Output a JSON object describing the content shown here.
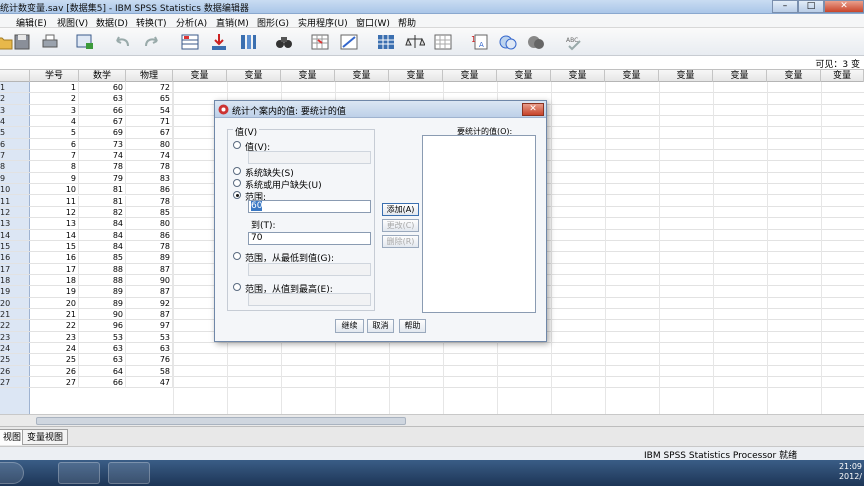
{
  "window": {
    "title": "统计数变量.sav [数据集5] - IBM SPSS Statistics 数据编辑器",
    "min": "–",
    "max": "□",
    "close": "✕"
  },
  "menu": [
    "编辑(E)",
    "视图(V)",
    "数据(D)",
    "转换(T)",
    "分析(A)",
    "直销(M)",
    "图形(G)",
    "实用程序(U)",
    "窗口(W)",
    "帮助"
  ],
  "visible_label": "可见：3 变",
  "columns": [
    "学号",
    "数学",
    "物理",
    "变量",
    "变量",
    "变量",
    "变量",
    "变量",
    "变量",
    "变量",
    "变量",
    "变量",
    "变量",
    "变量",
    "变量",
    "变量"
  ],
  "rows": [
    {
      "n": "1",
      "c": [
        "1",
        "60",
        "72"
      ]
    },
    {
      "n": "2",
      "c": [
        "2",
        "63",
        "65"
      ]
    },
    {
      "n": "3",
      "c": [
        "3",
        "66",
        "54"
      ]
    },
    {
      "n": "4",
      "c": [
        "4",
        "67",
        "71"
      ]
    },
    {
      "n": "5",
      "c": [
        "5",
        "69",
        "67"
      ]
    },
    {
      "n": "6",
      "c": [
        "6",
        "73",
        "80"
      ]
    },
    {
      "n": "7",
      "c": [
        "7",
        "74",
        "74"
      ]
    },
    {
      "n": "8",
      "c": [
        "8",
        "78",
        "78"
      ]
    },
    {
      "n": "9",
      "c": [
        "9",
        "79",
        "83"
      ]
    },
    {
      "n": "10",
      "c": [
        "10",
        "81",
        "86"
      ]
    },
    {
      "n": "11",
      "c": [
        "11",
        "81",
        "78"
      ]
    },
    {
      "n": "12",
      "c": [
        "12",
        "82",
        "85"
      ]
    },
    {
      "n": "13",
      "c": [
        "13",
        "84",
        "80"
      ]
    },
    {
      "n": "14",
      "c": [
        "14",
        "84",
        "86"
      ]
    },
    {
      "n": "15",
      "c": [
        "15",
        "84",
        "78"
      ]
    },
    {
      "n": "16",
      "c": [
        "16",
        "85",
        "89"
      ]
    },
    {
      "n": "17",
      "c": [
        "17",
        "88",
        "87"
      ]
    },
    {
      "n": "18",
      "c": [
        "18",
        "88",
        "90"
      ]
    },
    {
      "n": "19",
      "c": [
        "19",
        "89",
        "87"
      ]
    },
    {
      "n": "20",
      "c": [
        "20",
        "89",
        "92"
      ]
    },
    {
      "n": "21",
      "c": [
        "21",
        "90",
        "87"
      ]
    },
    {
      "n": "22",
      "c": [
        "22",
        "96",
        "97"
      ]
    },
    {
      "n": "23",
      "c": [
        "23",
        "53",
        "53"
      ]
    },
    {
      "n": "24",
      "c": [
        "24",
        "63",
        "63"
      ]
    },
    {
      "n": "25",
      "c": [
        "25",
        "63",
        "76"
      ]
    },
    {
      "n": "26",
      "c": [
        "26",
        "64",
        "58"
      ]
    },
    {
      "n": "27",
      "c": [
        "27",
        "66",
        "47"
      ]
    }
  ],
  "tabs": {
    "data_view": "视图",
    "variable_view": "变量视图"
  },
  "status": {
    "processor": "IBM SPSS Statistics Processor 就绪"
  },
  "clock": {
    "time": "21:09",
    "date": "2012/"
  },
  "dialog": {
    "title": "统计个案内的值: 要统计的值",
    "group_label": "值(V)",
    "opt_value": "值(V):",
    "opt_sysmis": "系统缺失(S)",
    "opt_sys_user_mis": "系统或用户缺失(U)",
    "opt_range": "范围:",
    "range_from": "60",
    "to_label": "到(T):",
    "range_to": "70",
    "opt_low_to": "范围，从最低到值(G):",
    "opt_to_high": "范围，从值到最高(E):",
    "list_label": "要统计的值(O):",
    "add": "添加(A)",
    "change": "更改(C)",
    "remove": "删除(R)",
    "continue": "继续",
    "cancel": "取消",
    "help": "帮助"
  },
  "colors": {
    "accent": "#3a78c4",
    "titlebar": "#bdd0e8"
  }
}
